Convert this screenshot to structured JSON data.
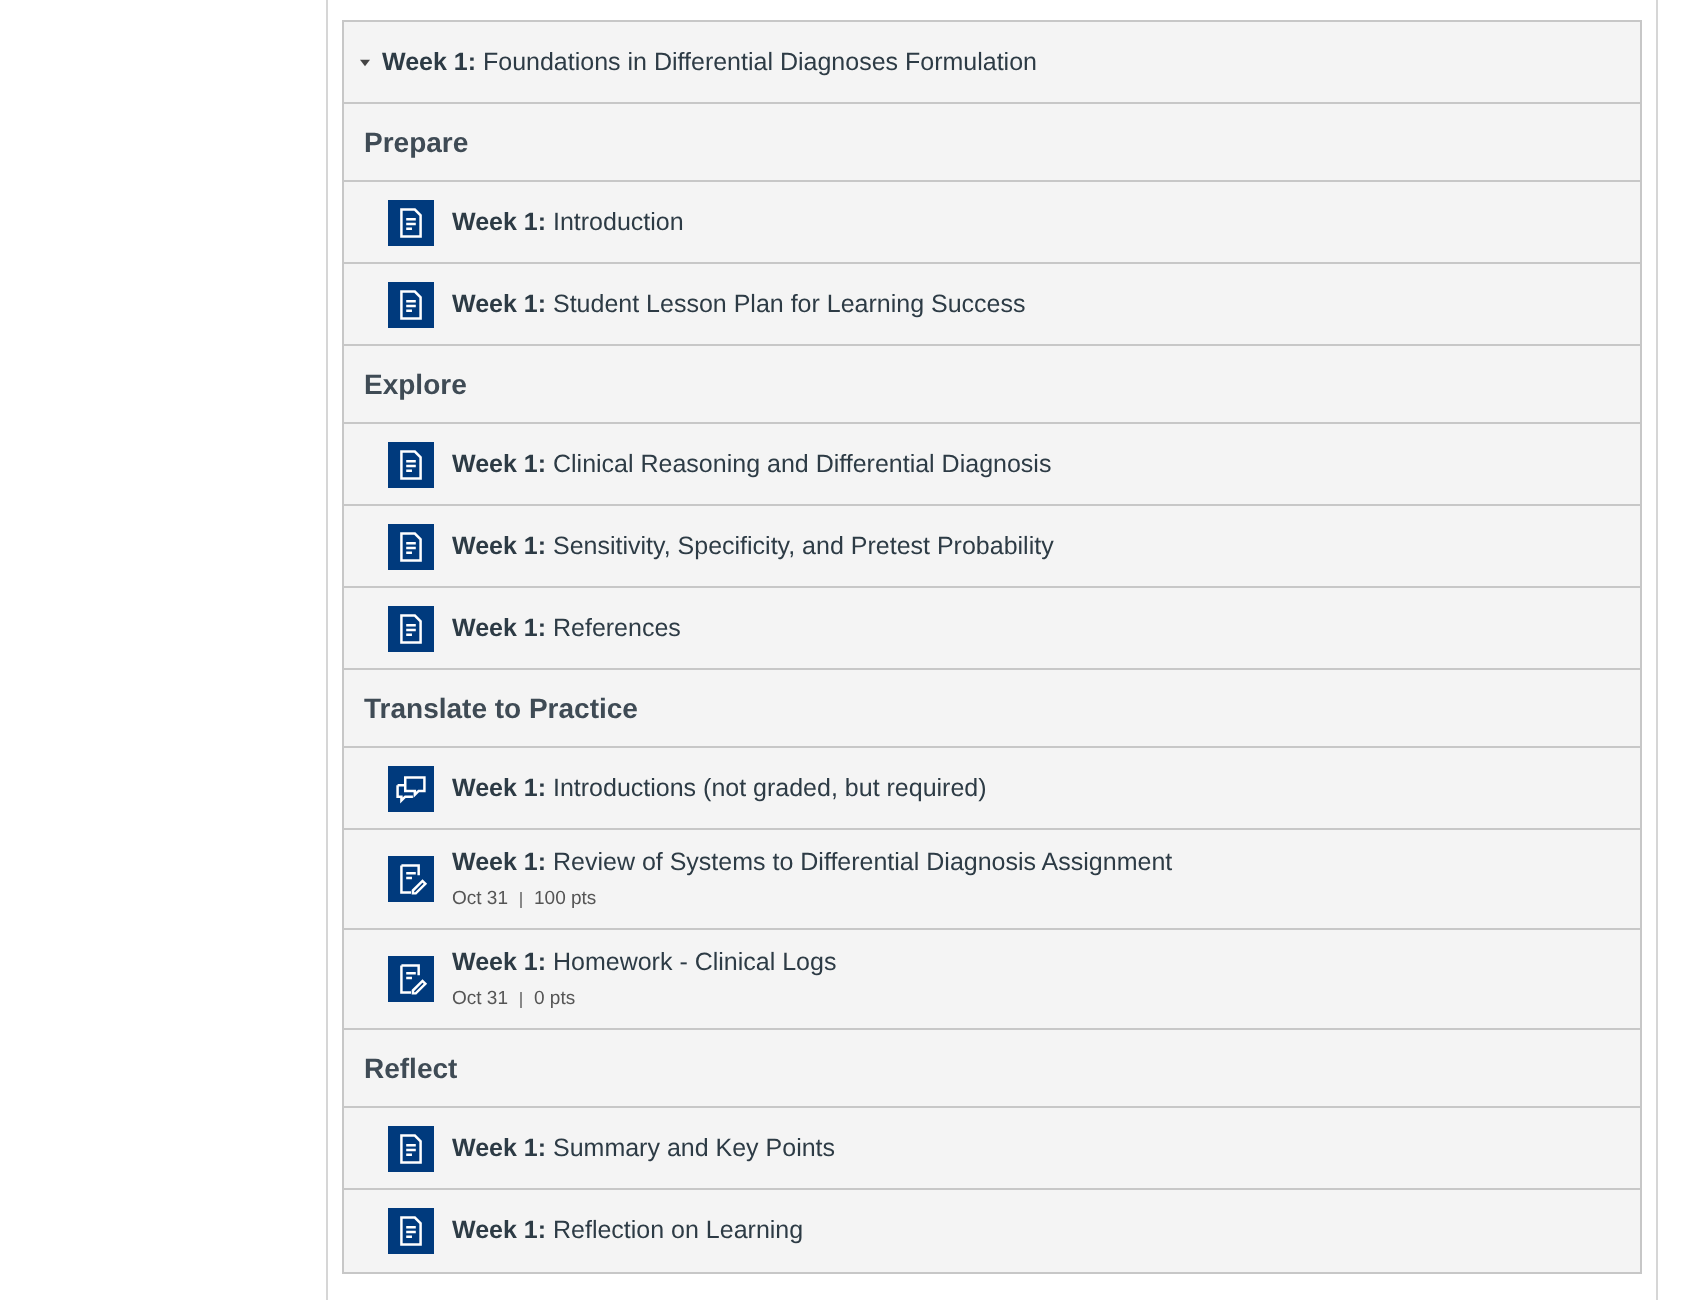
{
  "module": {
    "title": "**Week 1:** Foundations in Differential Diagnoses Formulation",
    "expanded": true,
    "sections": [
      {
        "heading": "Prepare",
        "items": [
          {
            "kind": "page",
            "title": "**Week 1:** Introduction"
          },
          {
            "kind": "page",
            "title": "**Week 1:** Student Lesson Plan for Learning Success"
          }
        ]
      },
      {
        "heading": "Explore",
        "items": [
          {
            "kind": "page",
            "title": "**Week 1:** Clinical Reasoning and Differential Diagnosis"
          },
          {
            "kind": "page",
            "title": "**Week 1:** Sensitivity, Specificity, and Pretest Probability"
          },
          {
            "kind": "page",
            "title": "**Week 1:** References"
          }
        ]
      },
      {
        "heading": "Translate to Practice",
        "items": [
          {
            "kind": "discussion",
            "title": "**Week 1:** Introductions (not graded, but required)"
          },
          {
            "kind": "assignment",
            "title": "**Week 1:** Review of Systems to Differential Diagnosis Assignment",
            "due": "Oct 31",
            "points": "100 pts"
          },
          {
            "kind": "assignment",
            "title": "**Week 1:** Homework - Clinical Logs",
            "due": "Oct 31",
            "points": "0 pts"
          }
        ]
      },
      {
        "heading": "Reflect",
        "items": [
          {
            "kind": "page",
            "title": "**Week 1:** Summary and Key Points"
          },
          {
            "kind": "page",
            "title": "**Week 1:** Reflection on Learning"
          }
        ]
      }
    ]
  }
}
